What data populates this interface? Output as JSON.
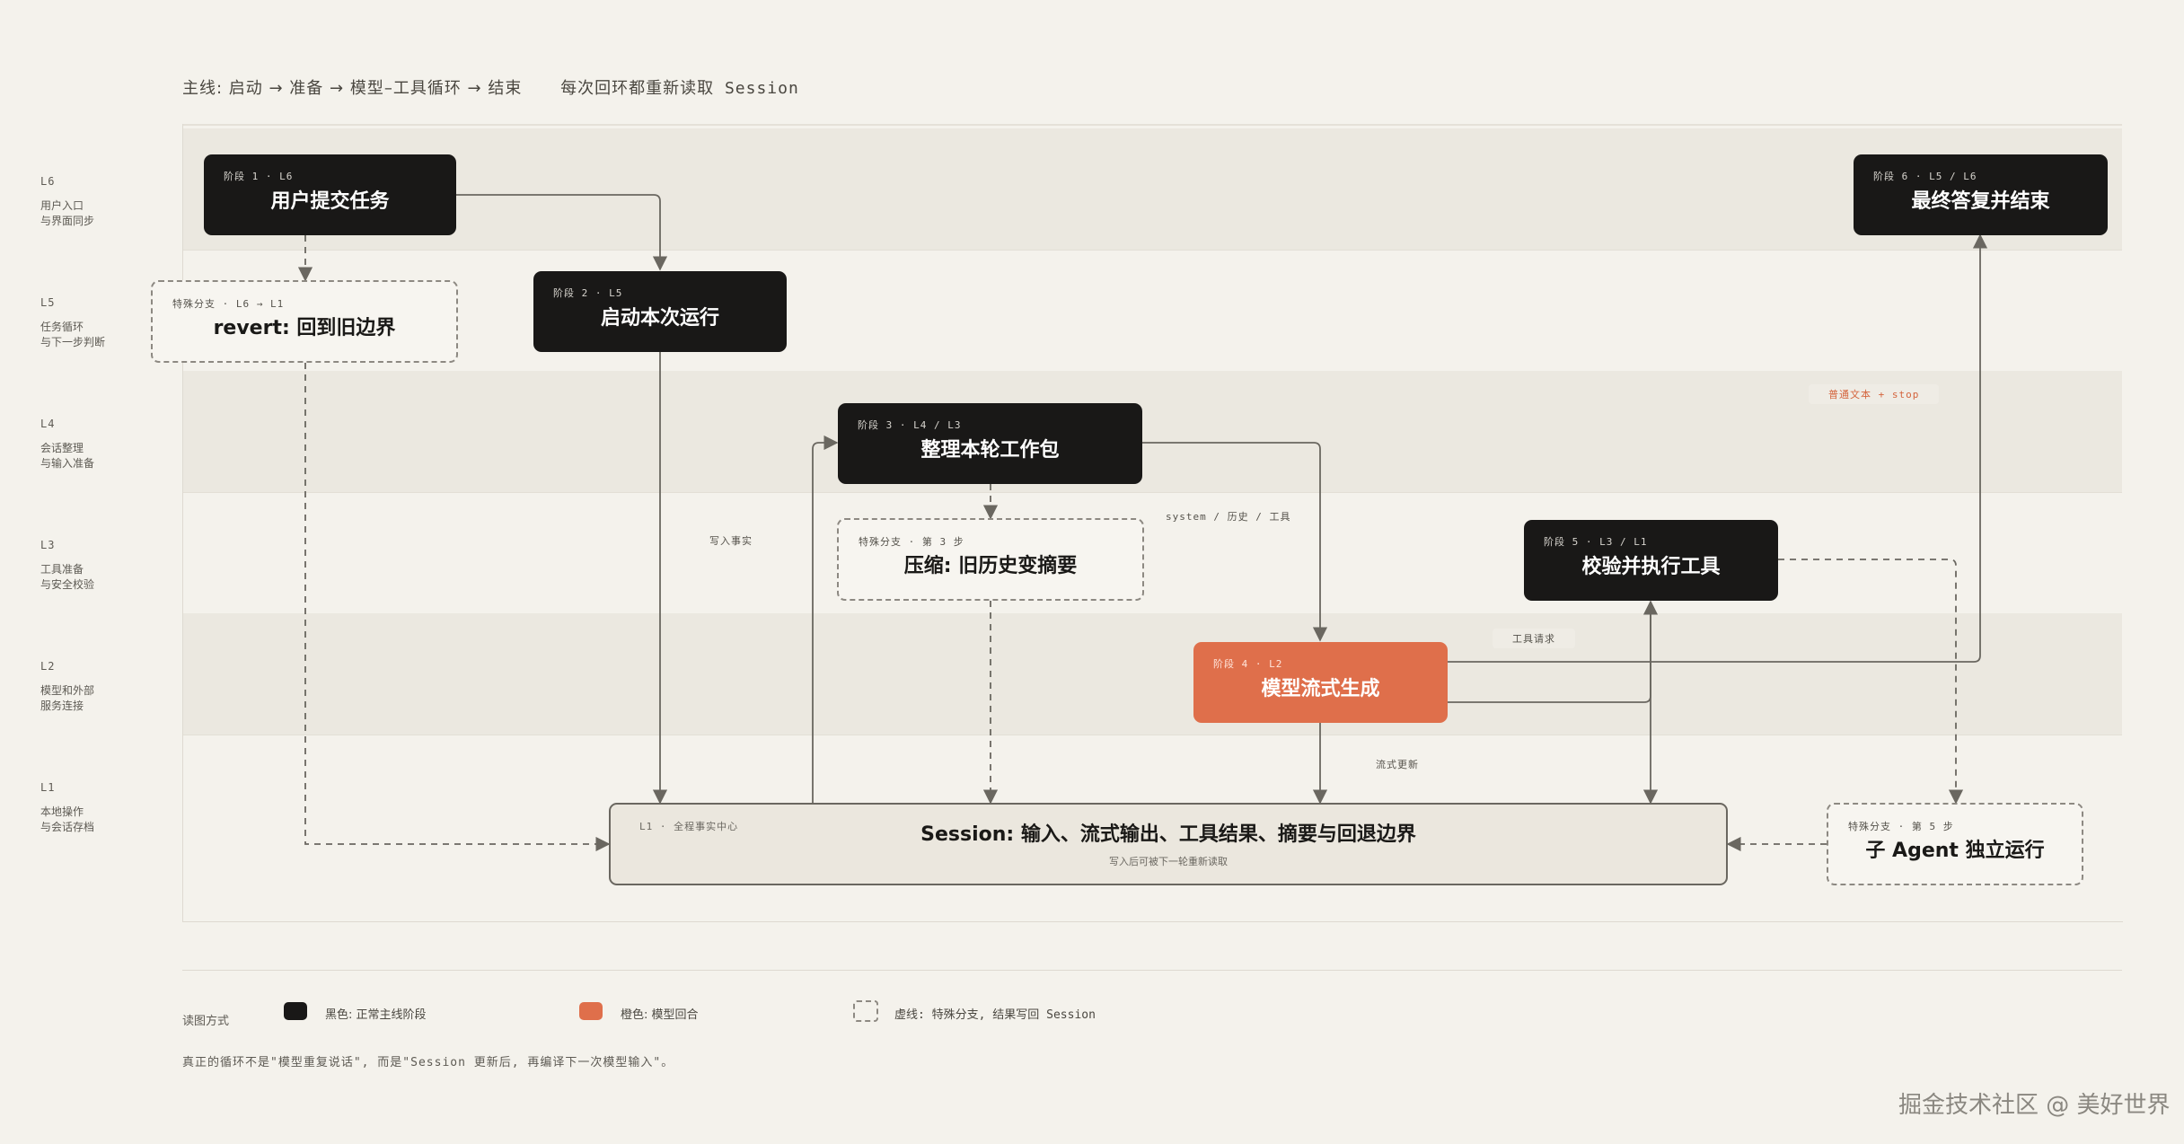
{
  "header": {
    "main_flow": "主线: 启动 → 准备 → 模型–工具循环 → 结束",
    "note": "每次回环都重新读取 Session"
  },
  "lanes": [
    {
      "code": "L6",
      "desc": "用户入口\n与界面同步"
    },
    {
      "code": "L5",
      "desc": "任务循环\n与下一步判断"
    },
    {
      "code": "L4",
      "desc": "会话整理\n与输入准备"
    },
    {
      "code": "L3",
      "desc": "工具准备\n与安全校验"
    },
    {
      "code": "L2",
      "desc": "模型和外部\n服务连接"
    },
    {
      "code": "L1",
      "desc": "本地操作\n与会话存档"
    }
  ],
  "nodes": {
    "stage1": {
      "tag": "阶段 1 · L6",
      "title": "用户提交任务"
    },
    "stage2": {
      "tag": "阶段 2 · L5",
      "title": "启动本次运行"
    },
    "stage3": {
      "tag": "阶段 3 · L4 / L3",
      "title": "整理本轮工作包"
    },
    "stage4": {
      "tag": "阶段 4 · L2",
      "title": "模型流式生成"
    },
    "stage5": {
      "tag": "阶段 5 · L3 / L1",
      "title": "校验并执行工具"
    },
    "stage6": {
      "tag": "阶段 6 · L5 / L6",
      "title": "最终答复并结束"
    },
    "revert": {
      "tag": "特殊分支 · L6 → L1",
      "title": "revert: 回到旧边界"
    },
    "compress": {
      "tag": "特殊分支 · 第 3 步",
      "title": "压缩: 旧历史变摘要"
    },
    "subagent": {
      "tag": "特殊分支 · 第 5 步",
      "title": "子 Agent 独立运行"
    },
    "session": {
      "tag": "L1 · 全程事实中心",
      "title": "Session: 输入、流式输出、工具结果、摘要与回退边界",
      "sub": "写入后可被下一轮重新读取"
    }
  },
  "edge_labels": {
    "write_facts": "写入事实",
    "system_history_tools": "system / 历史 / 工具",
    "tool_request": "工具请求",
    "text_stop": "普通文本 + stop",
    "stream_update": "流式更新"
  },
  "legend": {
    "title": "读图方式",
    "black": "黑色: 正常主线阶段",
    "orange": "橙色: 模型回合",
    "dashed": "虚线: 特殊分支, 结果写回 Session",
    "colors": {
      "black": "#191817",
      "orange": "#df6f4b",
      "dashed": "#8d8982"
    }
  },
  "footnote": "真正的循环不是\"模型重复说话\", 而是\"Session 更新后, 再编译下一次模型输入\"。",
  "watermark": "掘金技术社区 @ 美好世界"
}
